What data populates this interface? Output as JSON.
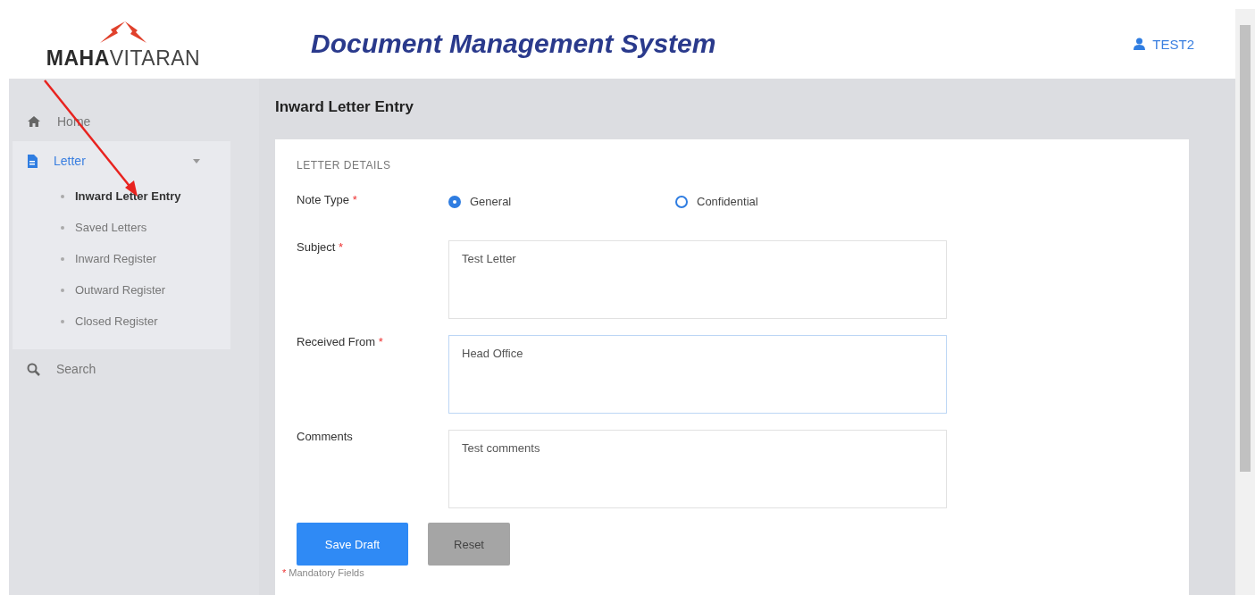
{
  "header": {
    "logo": {
      "bold": "MAHA",
      "light": "VITARAN"
    },
    "title": "Document Management System",
    "user": "TEST2"
  },
  "sidebar": {
    "items": [
      {
        "label": "Home",
        "selected": false
      },
      {
        "label": "Letter",
        "selected": true,
        "expanded": true,
        "children": [
          {
            "label": "Inward Letter Entry",
            "selected": true
          },
          {
            "label": "Saved Letters",
            "selected": false
          },
          {
            "label": "Inward Register",
            "selected": false
          },
          {
            "label": "Outward Register",
            "selected": false
          },
          {
            "label": "Closed Register",
            "selected": false
          }
        ]
      },
      {
        "label": "Search",
        "selected": false
      }
    ]
  },
  "page_title": "Inward Letter Entry",
  "form": {
    "section": "LETTER DETAILS",
    "note_type": {
      "label": "Note Type",
      "required_mark": "*",
      "options": [
        {
          "label": "General",
          "selected": true
        },
        {
          "label": "Confidential",
          "selected": false
        }
      ]
    },
    "fields": [
      {
        "label": "Subject",
        "required_mark": "*",
        "value": "Test Letter",
        "focused": false
      },
      {
        "label": "Received From",
        "required_mark": "*",
        "value": "Head Office",
        "focused": true
      },
      {
        "label": "Comments",
        "value": "Test comments",
        "focused": false
      }
    ],
    "buttons": [
      {
        "label": "Save Draft",
        "kind": "primary"
      },
      {
        "label": "Reset",
        "kind": "secondary"
      }
    ],
    "footnote": {
      "mark": "*",
      "text": "Mandatory Fields"
    }
  }
}
